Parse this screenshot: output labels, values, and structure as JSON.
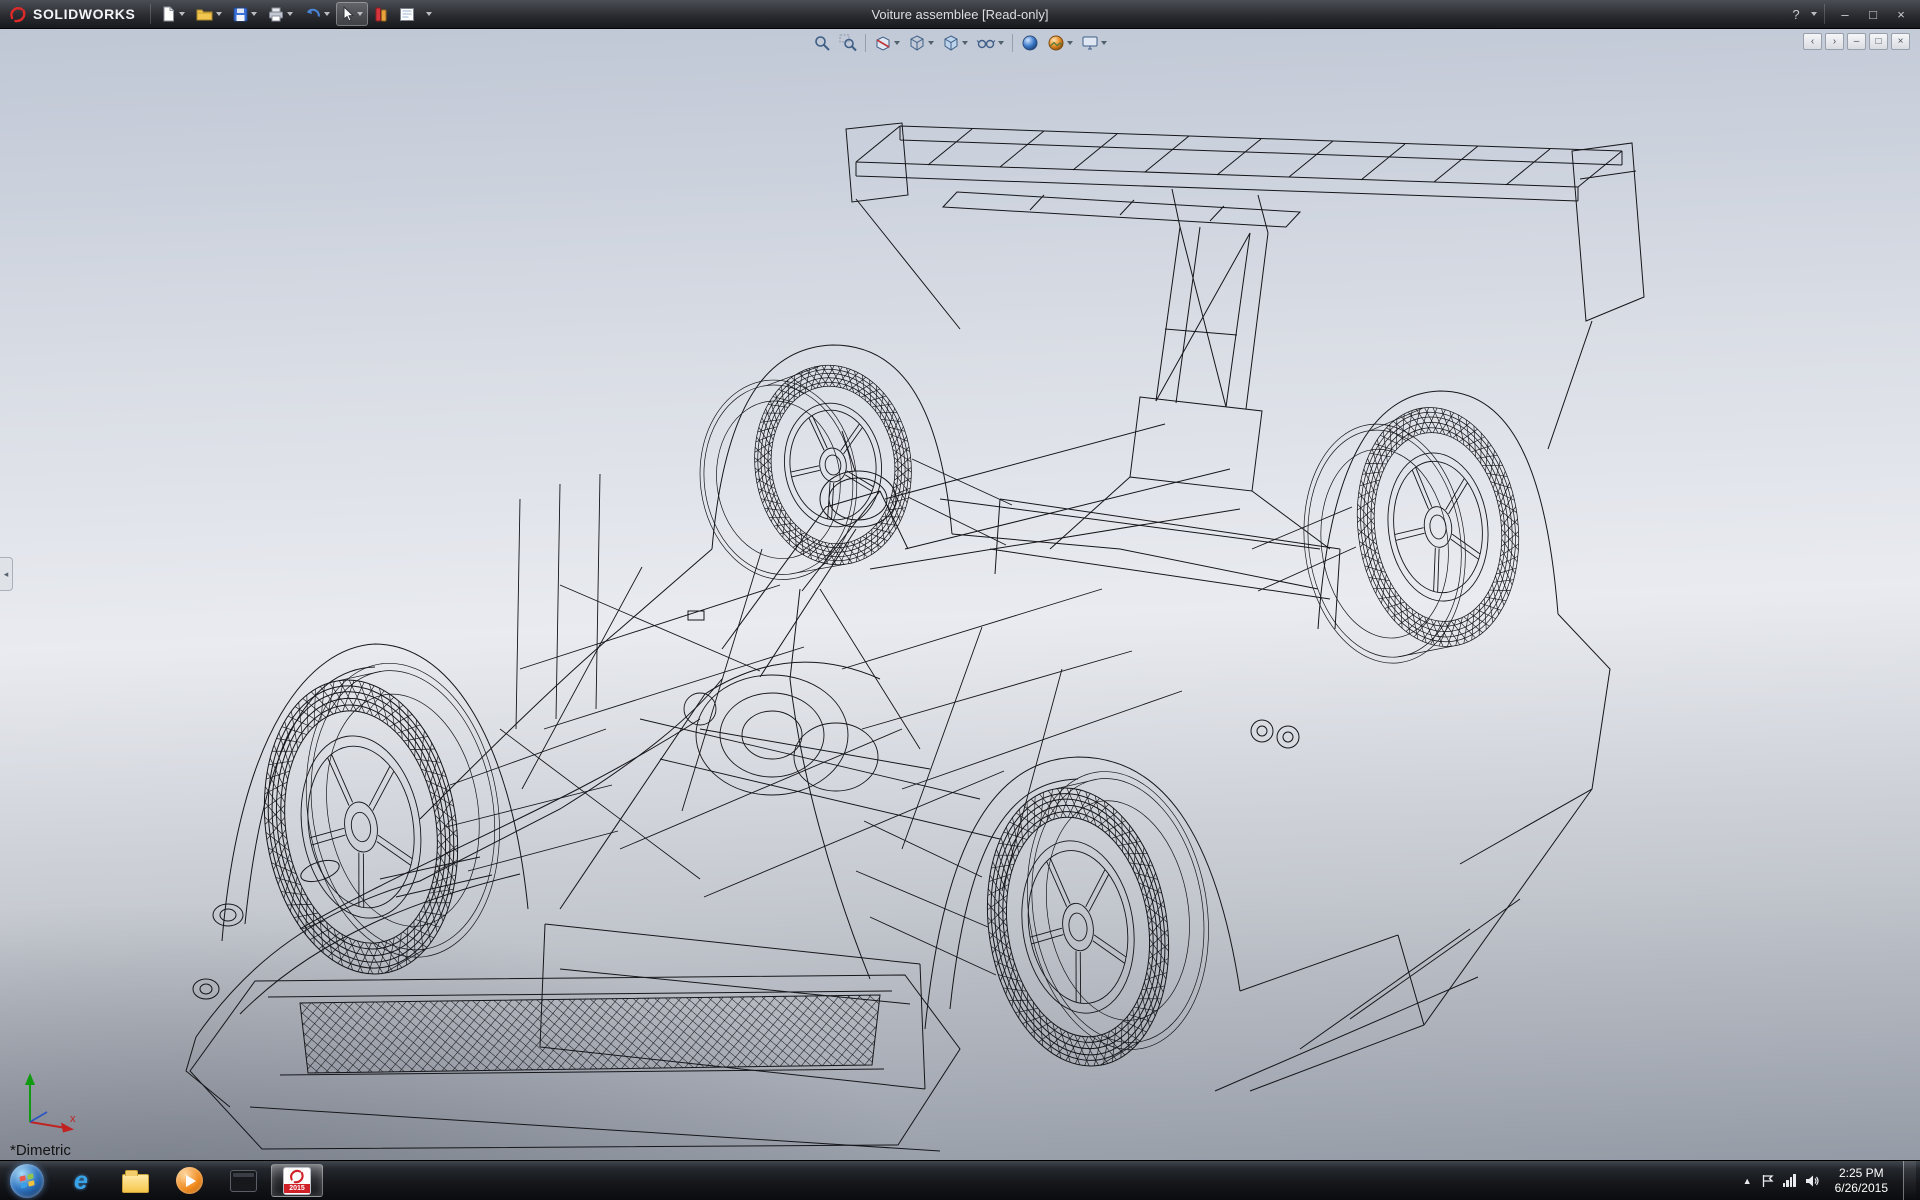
{
  "window": {
    "app_name": "SOLIDWORKS",
    "title": "Voiture assemblee [Read-only]",
    "controls": {
      "help": "?",
      "minimize": "–",
      "maximize": "□",
      "close": "×"
    }
  },
  "main_toolbar": {
    "items": [
      {
        "name": "new-document",
        "dropdown": true
      },
      {
        "name": "open",
        "dropdown": true
      },
      {
        "name": "save",
        "dropdown": true
      },
      {
        "name": "print",
        "dropdown": true
      },
      {
        "name": "undo",
        "dropdown": true
      },
      {
        "name": "select",
        "dropdown": true
      },
      {
        "name": "edit-appearance",
        "dropdown": false
      },
      {
        "name": "drawing-sheet",
        "dropdown": false
      },
      {
        "name": "toolbar-options",
        "dropdown": true
      }
    ]
  },
  "view_toolbar": {
    "items": [
      "zoom-to-fit",
      "zoom-to-area",
      "section-view",
      "view-orientation",
      "display-style",
      "hide-show-items",
      "edit-appearance",
      "apply-scene",
      "view-settings"
    ]
  },
  "viewport": {
    "view_label": "*Dimetric",
    "collapse_tab_glyph": "◂",
    "pane_controls": {
      "collapse": "‹",
      "expand": "›",
      "minimize": "–",
      "restore": "□",
      "close": "×"
    },
    "triad_labels": {
      "x": "x"
    }
  },
  "taskbar": {
    "time": "2:25 PM",
    "date": "6/26/2015",
    "items": [
      "start",
      "internet-explorer",
      "file-explorer",
      "media-player",
      "console",
      "solidworks"
    ],
    "active_item": "solidworks",
    "solidworks_badge": "2015",
    "ie_glyph": "e",
    "tray_expand_glyph": "▲"
  },
  "colors": {
    "accent_red": "#d02028",
    "triad_x": "#c22222",
    "triad_y": "#0f9a0f",
    "triad_z": "#2a55c2"
  }
}
